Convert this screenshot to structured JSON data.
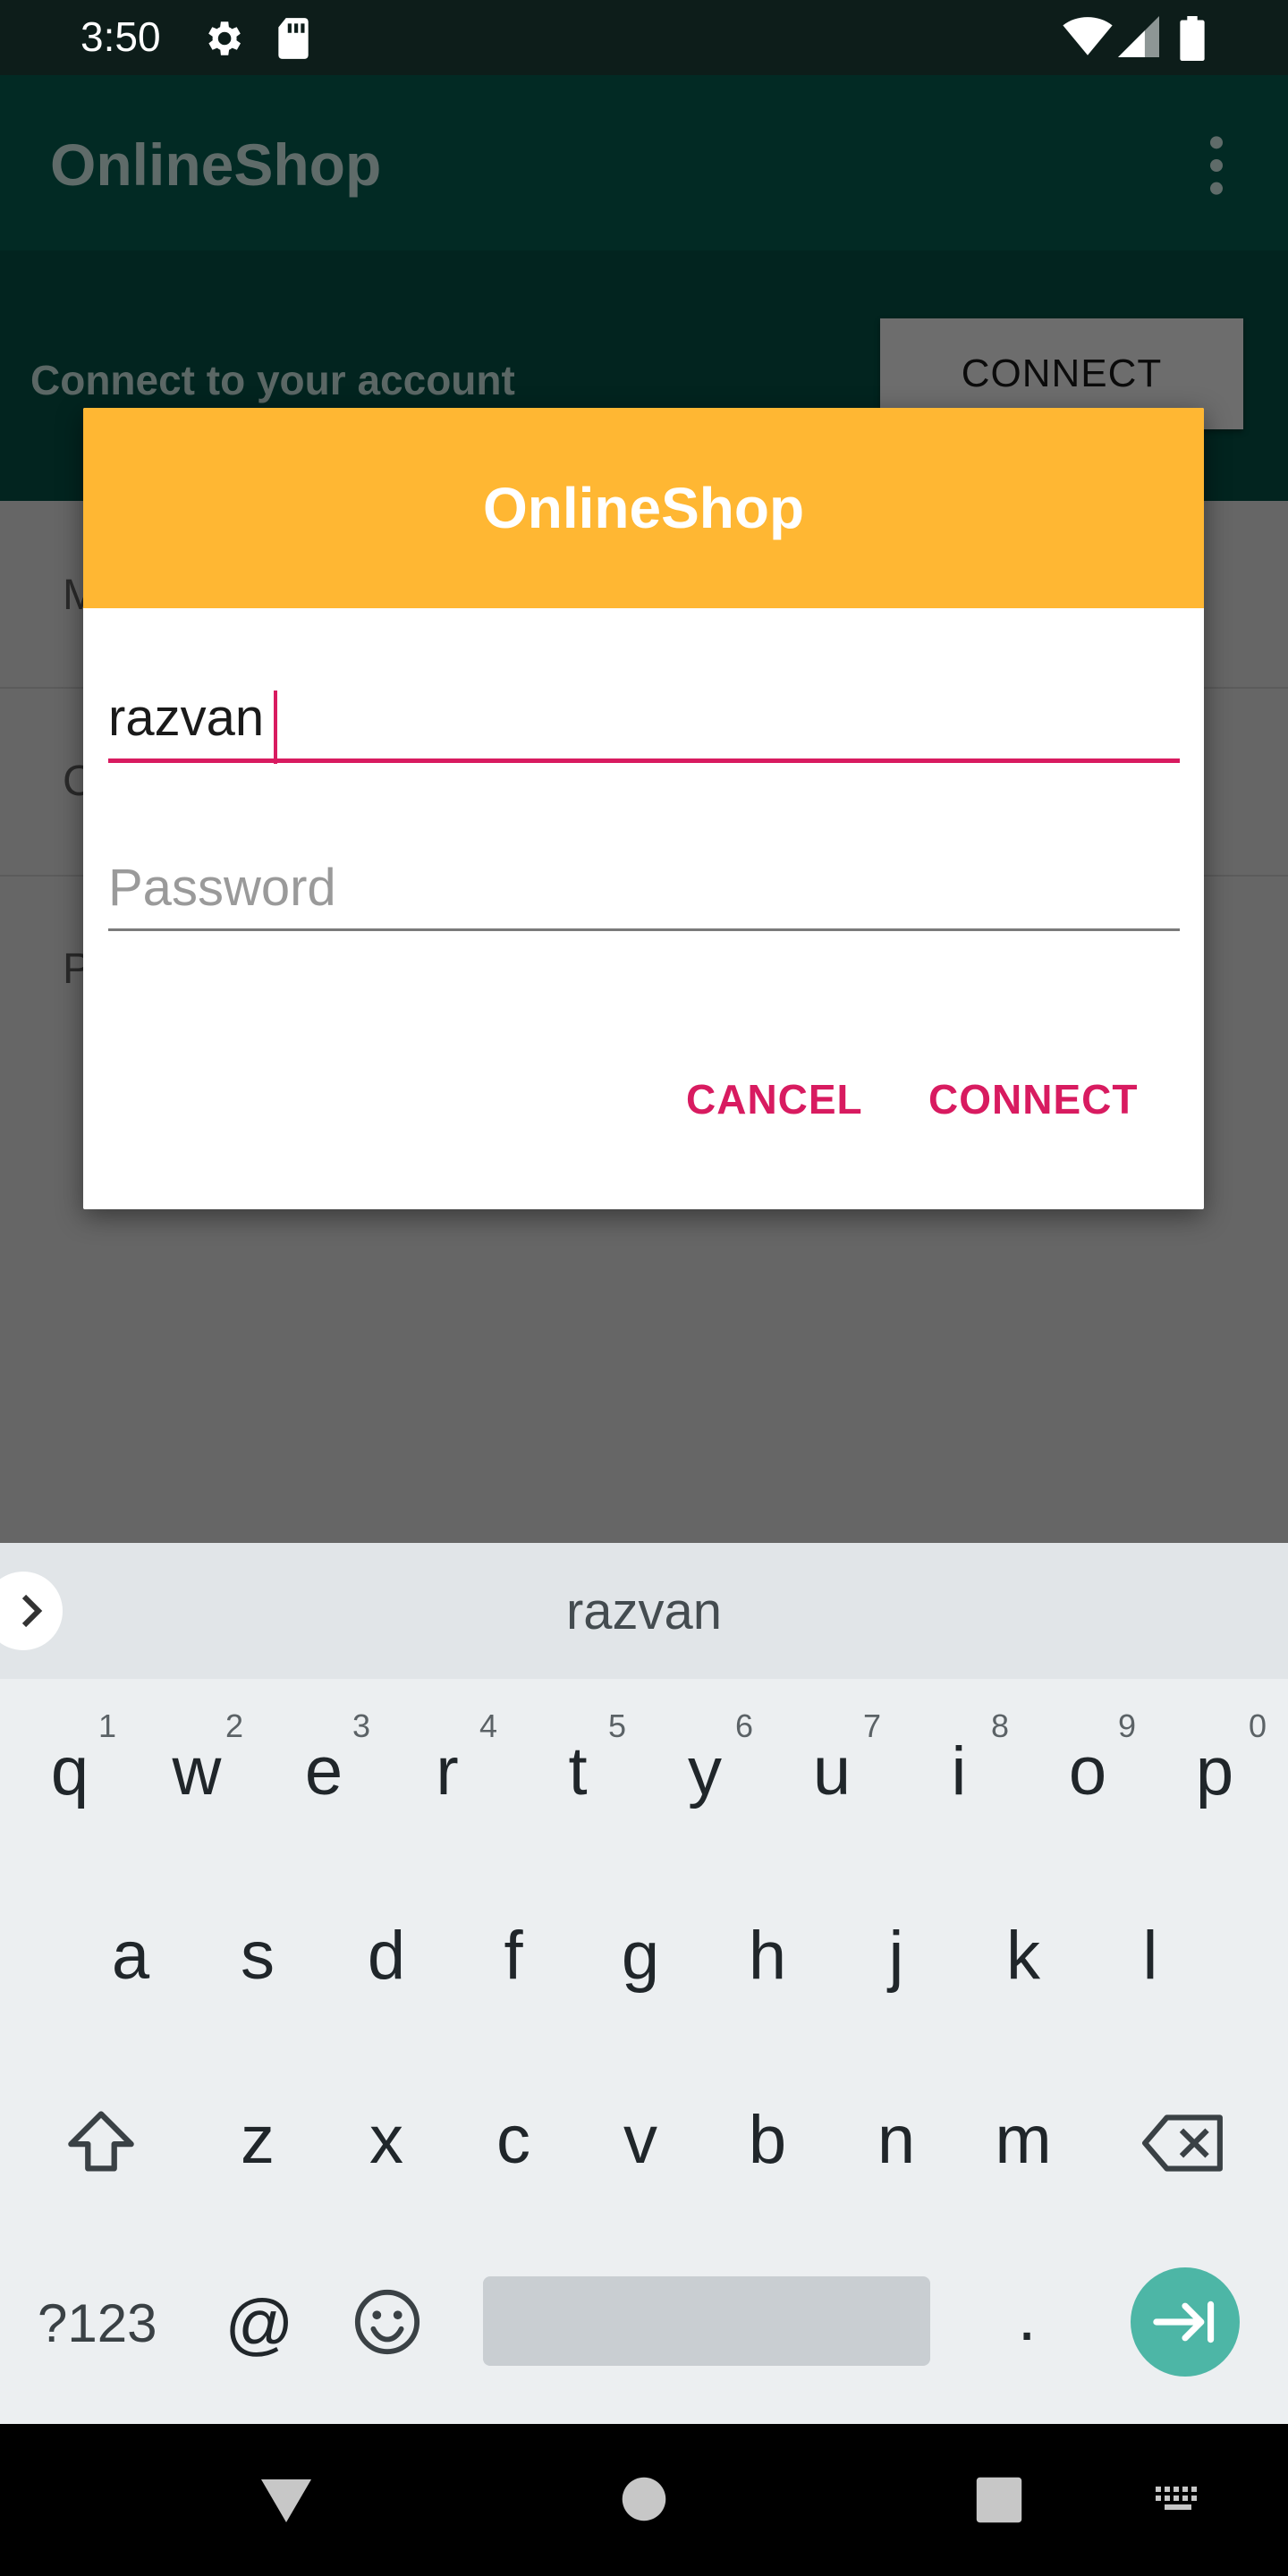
{
  "status_bar": {
    "time": "3:50",
    "icons": [
      "gear-icon",
      "sd-card-icon",
      "wifi-icon",
      "signal-icon",
      "battery-icon"
    ]
  },
  "app_bar": {
    "title": "OnlineShop",
    "menu_icon": "overflow-menu-icon"
  },
  "header": {
    "text": "Connect to your account",
    "button_label": "CONNECT"
  },
  "list_rows": [
    {
      "label": "M"
    },
    {
      "label": "C"
    },
    {
      "label": "P"
    }
  ],
  "dialog": {
    "title": "OnlineShop",
    "username_value": "razvan",
    "password_placeholder": "Password",
    "cancel_label": "CANCEL",
    "connect_label": "CONNECT"
  },
  "keyboard": {
    "suggestion": "razvan",
    "row1": [
      {
        "key": "q",
        "hint": "1"
      },
      {
        "key": "w",
        "hint": "2"
      },
      {
        "key": "e",
        "hint": "3"
      },
      {
        "key": "r",
        "hint": "4"
      },
      {
        "key": "t",
        "hint": "5"
      },
      {
        "key": "y",
        "hint": "6"
      },
      {
        "key": "u",
        "hint": "7"
      },
      {
        "key": "i",
        "hint": "8"
      },
      {
        "key": "o",
        "hint": "9"
      },
      {
        "key": "p",
        "hint": "0"
      }
    ],
    "row2": [
      "a",
      "s",
      "d",
      "f",
      "g",
      "h",
      "j",
      "k",
      "l"
    ],
    "row3": [
      "z",
      "x",
      "c",
      "v",
      "b",
      "n",
      "m"
    ],
    "symbols_label": "?123",
    "at_label": "@",
    "period_label": "."
  },
  "colors": {
    "dialog_header": "#ffb733",
    "accent": "#d81b60",
    "app_bar": "#022a24",
    "enter_key": "#4db6a6"
  }
}
